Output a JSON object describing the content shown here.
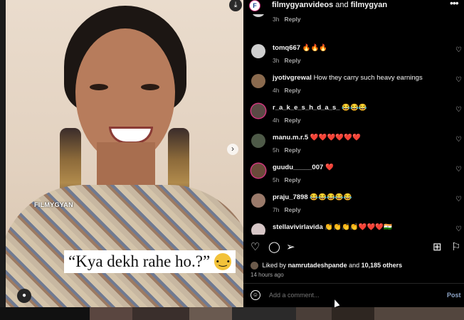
{
  "header": {
    "account1": "filmygyanvideos",
    "joiner": "and",
    "account2": "filmygyan",
    "more_icon": "more-horizontal-icon"
  },
  "media": {
    "watermark": "FILMYGYAN",
    "caption": "“Kya dekh rahe ho.?”",
    "download_icon": "download-icon",
    "next_icon": "chevron-right-icon",
    "tag_icon": "user-tag-icon"
  },
  "comments": [
    {
      "user": "tomq667",
      "text": "🔥🔥🔥",
      "time": "3h",
      "reply": "Reply",
      "avatar_color": "#cfcfcf",
      "ring": false
    },
    {
      "user": "tomq667",
      "text": "🔥🔥🔥",
      "time": "3h",
      "reply": "Reply",
      "avatar_color": "#cfcfcf",
      "ring": false
    },
    {
      "user": "jyotivgrewal",
      "text": "How they carry such heavy earnings",
      "time": "4h",
      "reply": "Reply",
      "avatar_color": "#8a6a4e",
      "ring": false
    },
    {
      "user": "r_a_k_e_s_h_d_a_s_",
      "text": "😂😂😂",
      "time": "4h",
      "reply": "Reply",
      "avatar_color": "#5a4a45",
      "ring": true
    },
    {
      "user": "manu.m.r.5",
      "text": "❤️❤️❤️❤️❤️❤️",
      "time": "5h",
      "reply": "Reply",
      "avatar_color": "#4e5a48",
      "ring": false
    },
    {
      "user": "guudu_____007",
      "text": "❤️",
      "time": "5h",
      "reply": "Reply",
      "avatar_color": "#6a4a3a",
      "ring": true
    },
    {
      "user": "praju_7898",
      "text": "😂😂😂😂😂",
      "time": "7h",
      "reply": "Reply",
      "avatar_color": "#9a7a6a",
      "ring": false
    },
    {
      "user": "stellavivirlavida",
      "text": "👏👏👏👏❤️❤️❤️🇮🇳",
      "time": "",
      "reply": "",
      "avatar_color": "#d6c6c6",
      "ring": false
    }
  ],
  "actions": {
    "like_icon": "heart-icon",
    "comment_icon": "comment-icon",
    "share_icon": "send-icon",
    "add_icon": "add-post-icon",
    "save_icon": "bookmark-icon"
  },
  "likes": {
    "prefix": "Liked by",
    "user": "namrutadeshpande",
    "joiner": "and",
    "others": "10,185 others"
  },
  "time_ago": "14 hours ago",
  "comment_box": {
    "placeholder": "Add a comment...",
    "post_label": "Post",
    "emoji_icon": "emoji-icon"
  }
}
